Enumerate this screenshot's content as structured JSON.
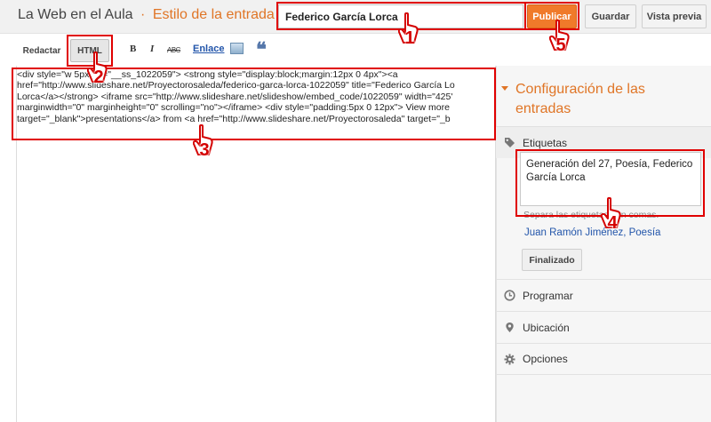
{
  "header": {
    "blog_title": "La Web en el Aula",
    "separator": "·",
    "post_state": "Estilo de la entrada",
    "post_title_value": "Federico García Lorca",
    "publish_label": "Publicar",
    "save_label": "Guardar",
    "preview_label": "Vista previa"
  },
  "toolbar": {
    "compose_label": "Redactar",
    "html_label": "HTML",
    "bold_glyph": "B",
    "italic_glyph": "I",
    "strike_glyph": "ABC",
    "link_label": "Enlace",
    "quote_glyph": "❝",
    "icons": [
      "bold-icon",
      "italic-icon",
      "strikethrough-icon",
      "image-icon",
      "quote-icon"
    ]
  },
  "editor": {
    "code_lines": [
      "<div style=\"w      5px\" id=\"__ss_1022059\"> <strong style=\"display:block;margin:12px 0 4px\"><a",
      "href=\"http://www.slideshare.net/Proyectorosaleda/federico-garca-lorca-1022059\" title=\"Federico García Lo",
      "Lorca</a></strong> <iframe src=\"http://www.slideshare.net/slideshow/embed_code/1022059\" width=\"425'",
      "marginwidth=\"0\" marginheight=\"0\" scrolling=\"no\"></iframe> <div style=\"padding:5px 0 12px\"> View more",
      "target=\"_blank\">presentations</a> from <a href=\"http://www.slideshare.net/Proyectorosaleda\" target=\"_b"
    ]
  },
  "sidebar": {
    "title": "Configuración de las entradas",
    "labels_heading": "Etiquetas",
    "labels_value": "Generación del 27, Poesía, Federico García Lorca",
    "labels_hint": "Separa las etiquetas con comas.",
    "suggestions": "Juan Ramón Jiménez, Poesía",
    "done_label": "Finalizado",
    "schedule_label": "Programar",
    "location_label": "Ubicación",
    "options_label": "Opciones"
  },
  "annotations": {
    "steps": [
      "1",
      "2",
      "3",
      "4",
      "5"
    ],
    "highlight_color": "#e00000"
  },
  "colors": {
    "accent": "#e07526",
    "publish": "#f07a2a",
    "link": "#2255aa"
  }
}
